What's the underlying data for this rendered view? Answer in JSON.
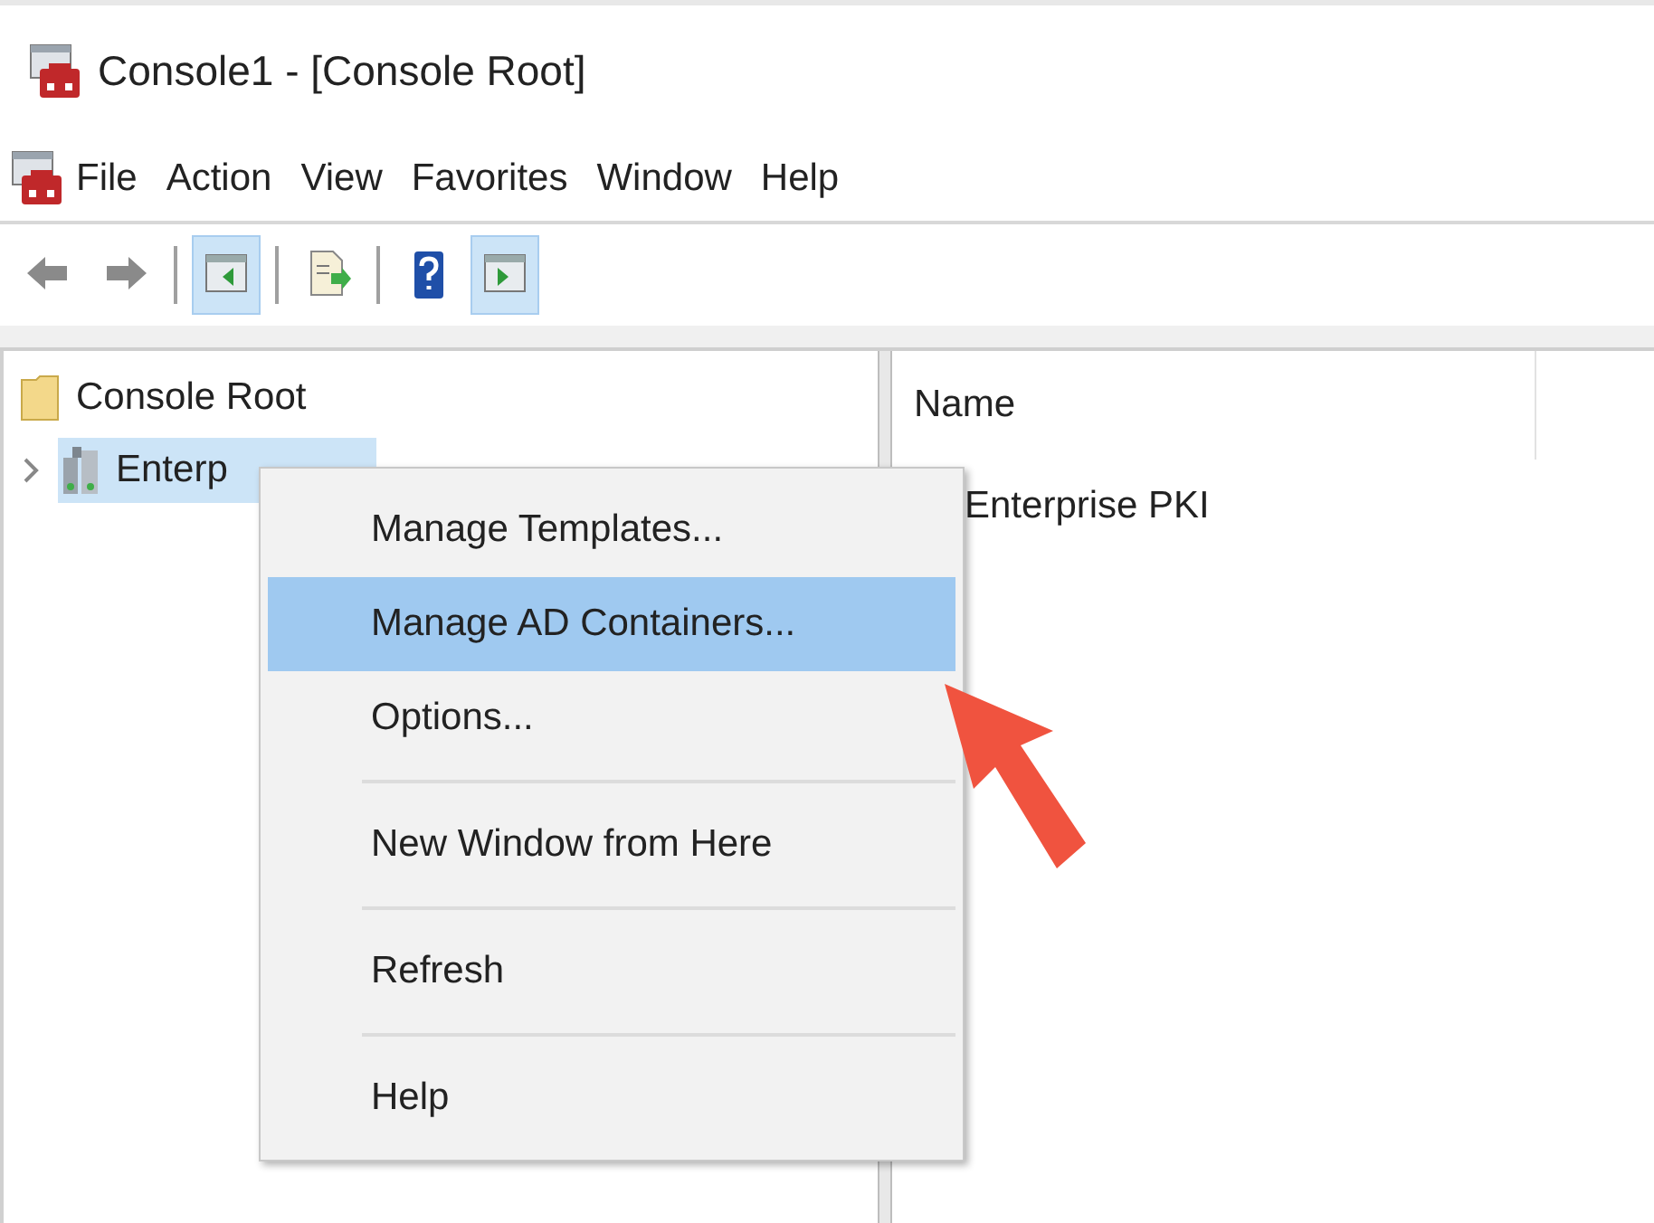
{
  "window": {
    "title": "Console1 - [Console Root]"
  },
  "menu_bar": [
    "File",
    "Action",
    "View",
    "Favorites",
    "Window",
    "Help"
  ],
  "toolbar": [
    {
      "kind": "back",
      "pressed": false
    },
    {
      "kind": "forward",
      "pressed": false
    },
    {
      "kind": "separator"
    },
    {
      "kind": "tree-toggle",
      "pressed": true
    },
    {
      "kind": "separator"
    },
    {
      "kind": "export",
      "pressed": false
    },
    {
      "kind": "separator"
    },
    {
      "kind": "help",
      "pressed": false
    },
    {
      "kind": "action-pane",
      "pressed": true
    }
  ],
  "tree": [
    {
      "label": "Console Root",
      "selected": false,
      "children": [
        {
          "label": "Enterp",
          "selected": true,
          "expanded": false
        }
      ]
    }
  ],
  "list": {
    "columns": [
      "Name"
    ],
    "rows": [
      "Enterprise PKI"
    ]
  },
  "context_menu": {
    "items": [
      {
        "kind": "item",
        "label": "Manage Templates...",
        "selected": false
      },
      {
        "kind": "item",
        "label": "Manage AD Containers...",
        "selected": true
      },
      {
        "kind": "item",
        "label": "Options...",
        "selected": false
      },
      {
        "kind": "separator"
      },
      {
        "kind": "item",
        "label": "New Window from Here",
        "selected": false
      },
      {
        "kind": "separator"
      },
      {
        "kind": "item",
        "label": "Refresh",
        "selected": false
      },
      {
        "kind": "separator"
      },
      {
        "kind": "item",
        "label": "Help",
        "selected": false
      }
    ]
  }
}
